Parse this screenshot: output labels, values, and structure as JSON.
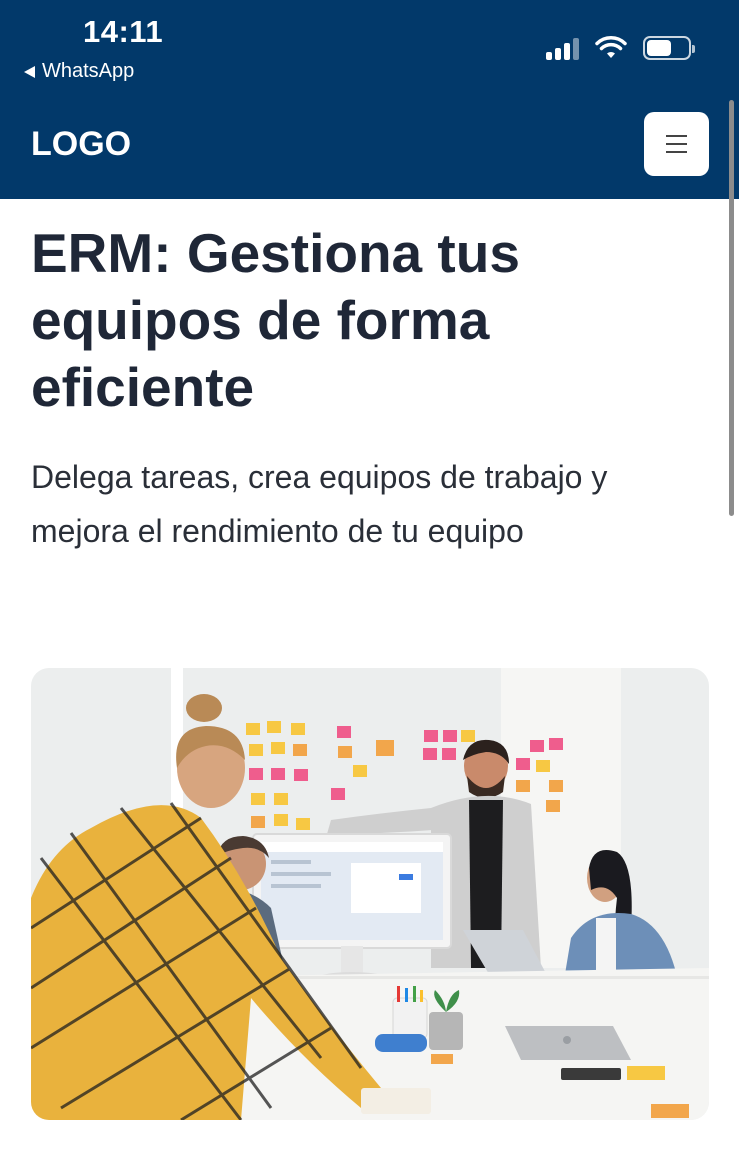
{
  "status_bar": {
    "time": "14:11",
    "back_app": "WhatsApp",
    "icons": [
      "signal-icon",
      "wifi-icon",
      "battery-icon"
    ]
  },
  "navbar": {
    "logo": "LOGO",
    "menu_icon": "hamburger-menu-icon",
    "background": "#02396A"
  },
  "hero": {
    "title": "ERM: Gestiona tus equipos de forma eficiente",
    "subtitle": "Delega tareas, crea equipos de trabajo y mejora el rendimiento de tu equipo",
    "image": "team-meeting-photo"
  }
}
